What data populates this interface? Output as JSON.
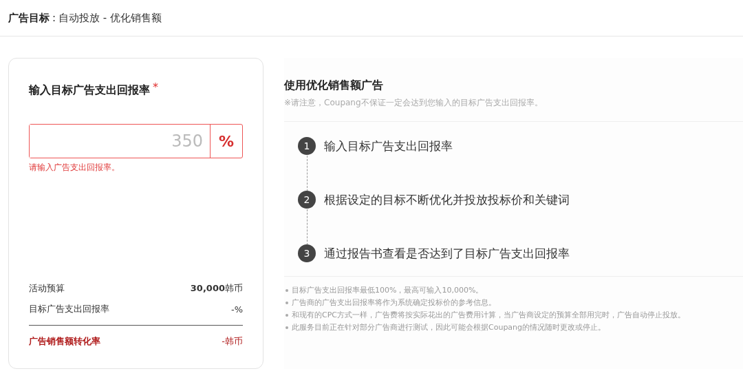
{
  "header": {
    "label": "广告目标",
    "separator": ":",
    "value": "自动投放 - 优化销售额"
  },
  "input_card": {
    "title": "输入目标广告支出回报率",
    "required_mark": "*",
    "field": {
      "placeholder": "350",
      "unit": "%",
      "error": true
    },
    "error_message": "请输入广告支出回报率。",
    "summary": [
      {
        "kind": "normal",
        "label": "活动预算",
        "value": "**30,000**韩币"
      },
      {
        "kind": "normal",
        "label": "目标广告支出回报率",
        "value": "-%"
      },
      {
        "kind": "total",
        "label": "广告销售额转化率",
        "value": "-韩币"
      }
    ]
  },
  "info": {
    "title": "使用优化销售额广告",
    "note": "※请注意，Coupang不保证一定会达到您输入的目标广告支出回报率。",
    "steps": [
      {
        "number": "1",
        "text": "输入目标广告支出回报率"
      },
      {
        "number": "2",
        "text": "根据设定的目标不断优化并投放投标价和关键词"
      },
      {
        "number": "3",
        "text": "通过报告书查看是否达到了目标广告支出回报率"
      }
    ],
    "bullets": [
      "目标广告支出回报率最低100%，最高可输入10,000%。",
      "广告商的广告支出回报率将作为系统确定投标价的参考信息。",
      "和现有的CPC方式一样，广告费将按实际花出的广告费用计算，当广告商设定的预算全部用完时，广告自动停止投放。",
      "此服务目前正在针对部分广告商进行测试，因此可能会根据Coupang的情况随时更改或停止。"
    ]
  }
}
